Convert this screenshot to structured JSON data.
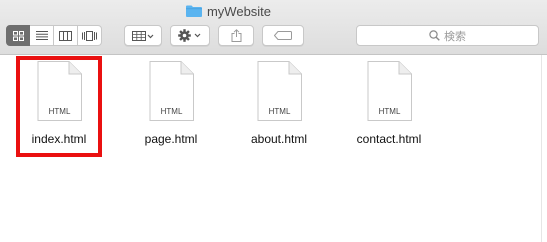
{
  "window": {
    "title": "myWebsite"
  },
  "toolbar": {
    "view_modes": [
      "icon-view",
      "list-view",
      "column-view",
      "cover-flow-view"
    ],
    "arrange_icon": "grid-icon",
    "action_icon": "gear-icon",
    "share_icon": "share-icon",
    "tag_icon": "tag-icon",
    "search_placeholder": "検索"
  },
  "files": [
    {
      "name": "index.html",
      "type_label": "HTML",
      "selected": true
    },
    {
      "name": "page.html",
      "type_label": "HTML",
      "selected": false
    },
    {
      "name": "about.html",
      "type_label": "HTML",
      "selected": false
    },
    {
      "name": "contact.html",
      "type_label": "HTML",
      "selected": false
    }
  ],
  "colors": {
    "highlight": "#ea1010",
    "folder": "#5ab4f0"
  }
}
